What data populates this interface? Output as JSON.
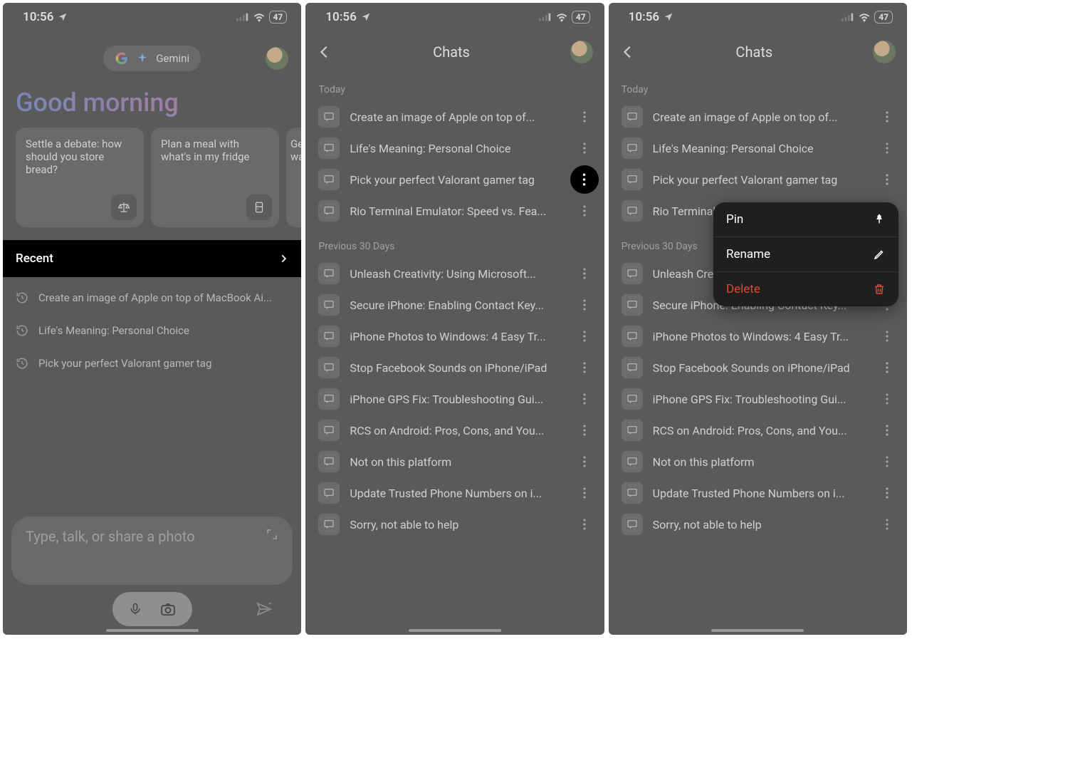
{
  "status": {
    "time": "10:56",
    "battery": "47"
  },
  "s1": {
    "gemini_label": "Gemini",
    "greeting": "Good morning",
    "suggestions": [
      "Settle a debate: how should you store bread?",
      "Plan a meal with what's in my fridge",
      "Ge\nwa"
    ],
    "recent_label": "Recent",
    "recent": [
      "Create an image of Apple on top of MacBook Ai...",
      "Life's Meaning: Personal Choice",
      "Pick your perfect Valorant gamer tag"
    ],
    "input_placeholder": "Type, talk, or share a photo"
  },
  "chats": {
    "title": "Chats",
    "groups": [
      {
        "label": "Today",
        "items": [
          "Create an image of Apple on top of...",
          "Life's Meaning: Personal Choice",
          "Pick your perfect Valorant gamer tag",
          "Rio Terminal Emulator: Speed vs. Fea..."
        ]
      },
      {
        "label": "Previous 30 Days",
        "items": [
          "Unleash Creativity: Using Microsoft...",
          "Secure iPhone: Enabling Contact Key...",
          "iPhone Photos to Windows: 4 Easy Tr...",
          "Stop Facebook Sounds on iPhone/iPad",
          "iPhone GPS Fix: Troubleshooting Gui...",
          "RCS on Android: Pros, Cons, and You...",
          "Not on this platform",
          "Update Trusted Phone Numbers on i...",
          "Sorry, not able to help"
        ]
      }
    ]
  },
  "s3": {
    "truncated_item": "Rio Terminal",
    "menu": {
      "pin": "Pin",
      "rename": "Rename",
      "delete": "Delete"
    }
  }
}
